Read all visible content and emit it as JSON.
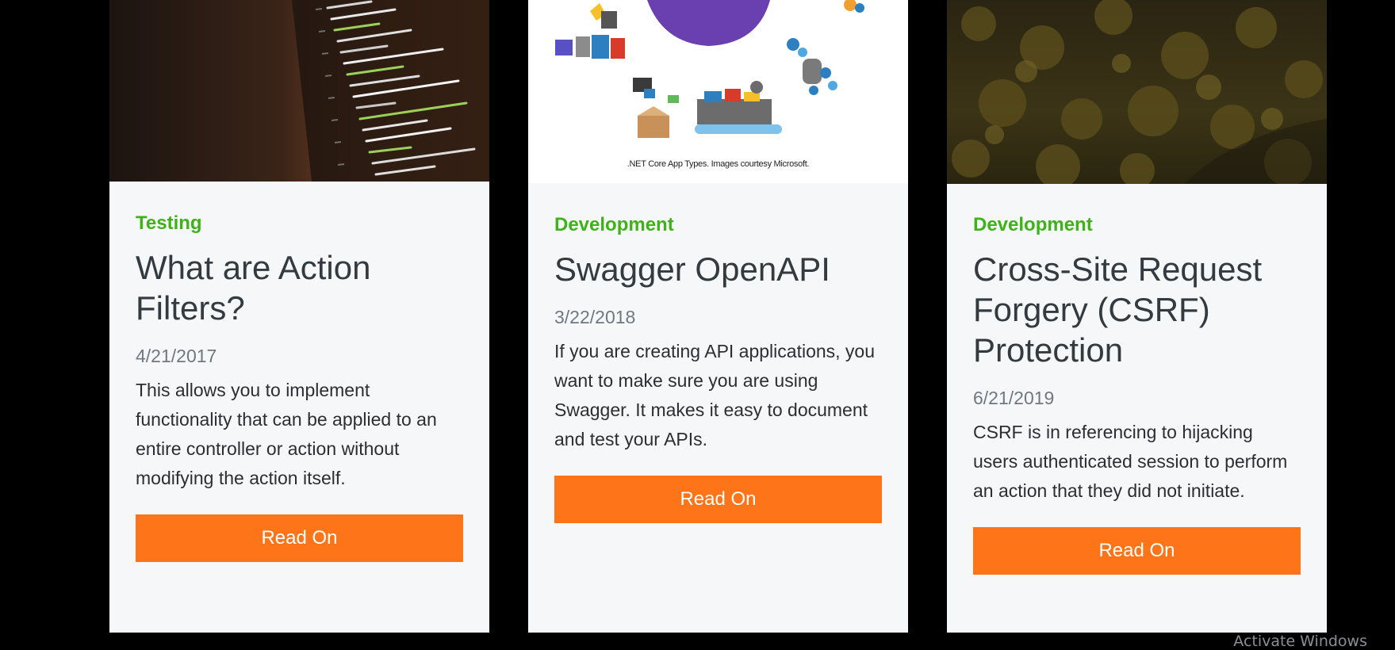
{
  "cards": [
    {
      "image_icon": "code-screen-photo",
      "category": "Testing",
      "title": "What are Action Filters?",
      "date": "4/21/2017",
      "excerpt": "This allows you to implement functionality that can be applied to an entire controller or action without modifying the action itself.",
      "button_label": "Read On"
    },
    {
      "image_icon": "dotnet-app-types-illustration",
      "image_caption": ".NET Core App Types. Images courtesy Microsoft.",
      "category": "Development",
      "title": "Swagger OpenAPI",
      "date": "3/22/2018",
      "excerpt": "If you are creating API applications, you want to make sure you are using Swagger. It makes it easy to document and test your APIs.",
      "button_label": "Read On"
    },
    {
      "image_icon": "forest-photo",
      "category": "Development",
      "title": "Cross-Site Request Forgery (CSRF) Protection",
      "date": "6/21/2019",
      "excerpt": "CSRF is in referencing to hijacking users authenticated session to perform an action that they did not initiate.",
      "button_label": "Read On"
    }
  ],
  "watermark": "Activate Windows",
  "colors": {
    "background": "#000000",
    "card": "#f6f7f8",
    "category": "#3fb21a",
    "button": "#fd7419"
  }
}
